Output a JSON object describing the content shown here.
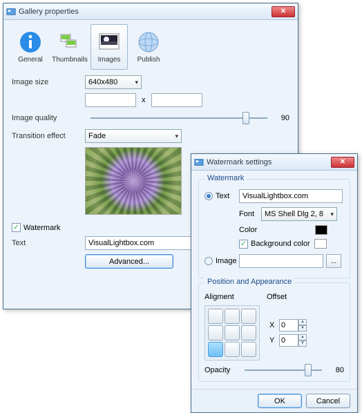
{
  "gallery": {
    "title": "Gallery properties",
    "tabs": [
      {
        "label": "General"
      },
      {
        "label": "Thumbnails"
      },
      {
        "label": "Images"
      },
      {
        "label": "Publish"
      }
    ],
    "selected_tab": 2,
    "image_size_label": "Image size",
    "image_size_value": "640x480",
    "width_value": "",
    "height_value": "",
    "dim_sep": "x",
    "quality_label": "Image quality",
    "quality_value": "90",
    "transition_label": "Transition effect",
    "transition_value": "Fade",
    "watermark_check_label": "Watermark",
    "watermark_checked": true,
    "text_label": "Text",
    "text_value": "VisualLightbox.com",
    "advanced_label": "Advanced..."
  },
  "watermark": {
    "title": "Watermark settings",
    "group_label": "Watermark",
    "text_radio_label": "Text",
    "text_value": "VisualLightbox.com",
    "font_label": "Font",
    "font_value": "MS Shell Dlg 2, 8",
    "color_label": "Color",
    "color_value": "#000000",
    "bgcolor_label": "Background color",
    "bgcolor_checked": true,
    "bgcolor_value": "#ffffff",
    "image_radio_label": "Image",
    "image_value": "",
    "browse_label": "...",
    "pos_group_label": "Position and Appearance",
    "alignment_label": "Aligment",
    "offset_label": "Offset",
    "x_label": "X",
    "x_value": "0",
    "y_label": "Y",
    "y_value": "0",
    "opacity_label": "Opacity",
    "opacity_value": "80",
    "ok_label": "OK",
    "cancel_label": "Cancel"
  }
}
